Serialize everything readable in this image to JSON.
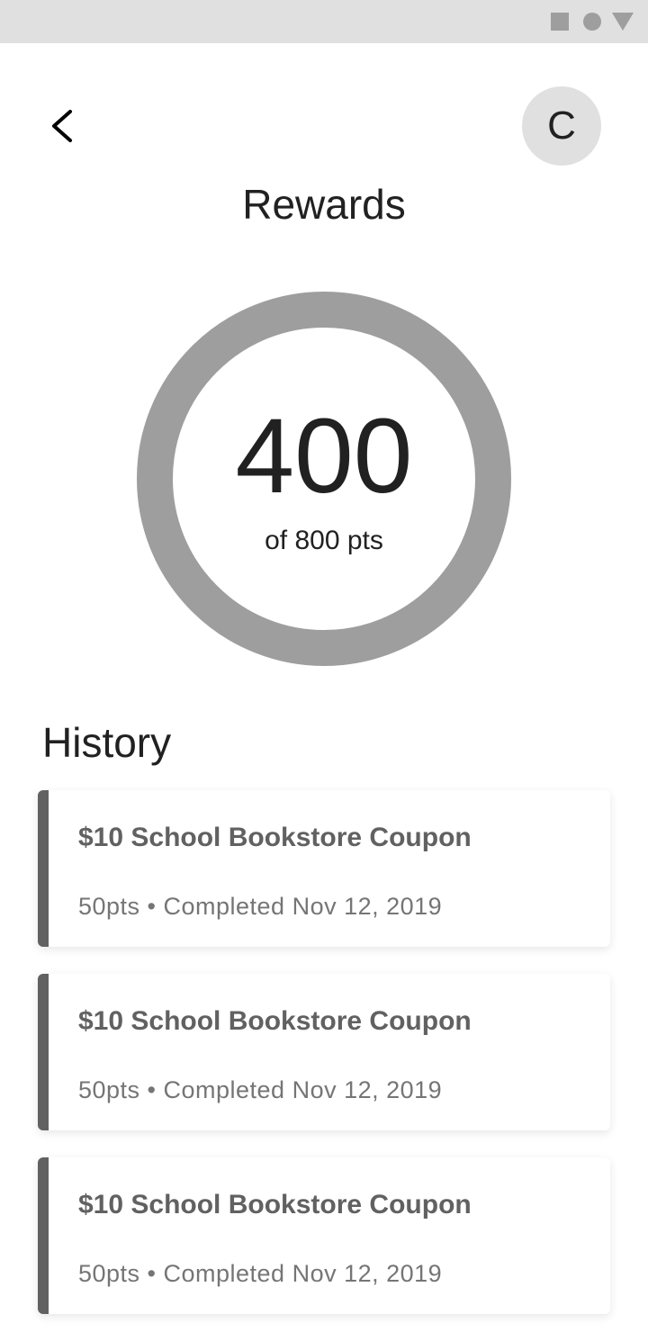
{
  "status_bar": {
    "icons": [
      "square-icon",
      "circle-icon",
      "triangle-icon"
    ]
  },
  "header": {
    "back_icon": "chevron-left-icon",
    "avatar_initial": "C",
    "title": "Rewards"
  },
  "progress": {
    "points": "400",
    "caption": "of 800 pts",
    "current": 400,
    "total": 800,
    "ring_color": "#9e9e9e"
  },
  "history": {
    "title": "History",
    "items": [
      {
        "title": "$10 School Bookstore Coupon",
        "meta": "50pts • Completed Nov 12, 2019"
      },
      {
        "title": "$10 School Bookstore Coupon",
        "meta": "50pts • Completed Nov 12, 2019"
      },
      {
        "title": "$10 School Bookstore Coupon",
        "meta": "50pts • Completed Nov 12, 2019"
      }
    ]
  },
  "colors": {
    "status_bar_bg": "#e0e0e0",
    "accent_bar": "#616161",
    "text_primary": "#212121",
    "text_secondary": "#757575"
  }
}
